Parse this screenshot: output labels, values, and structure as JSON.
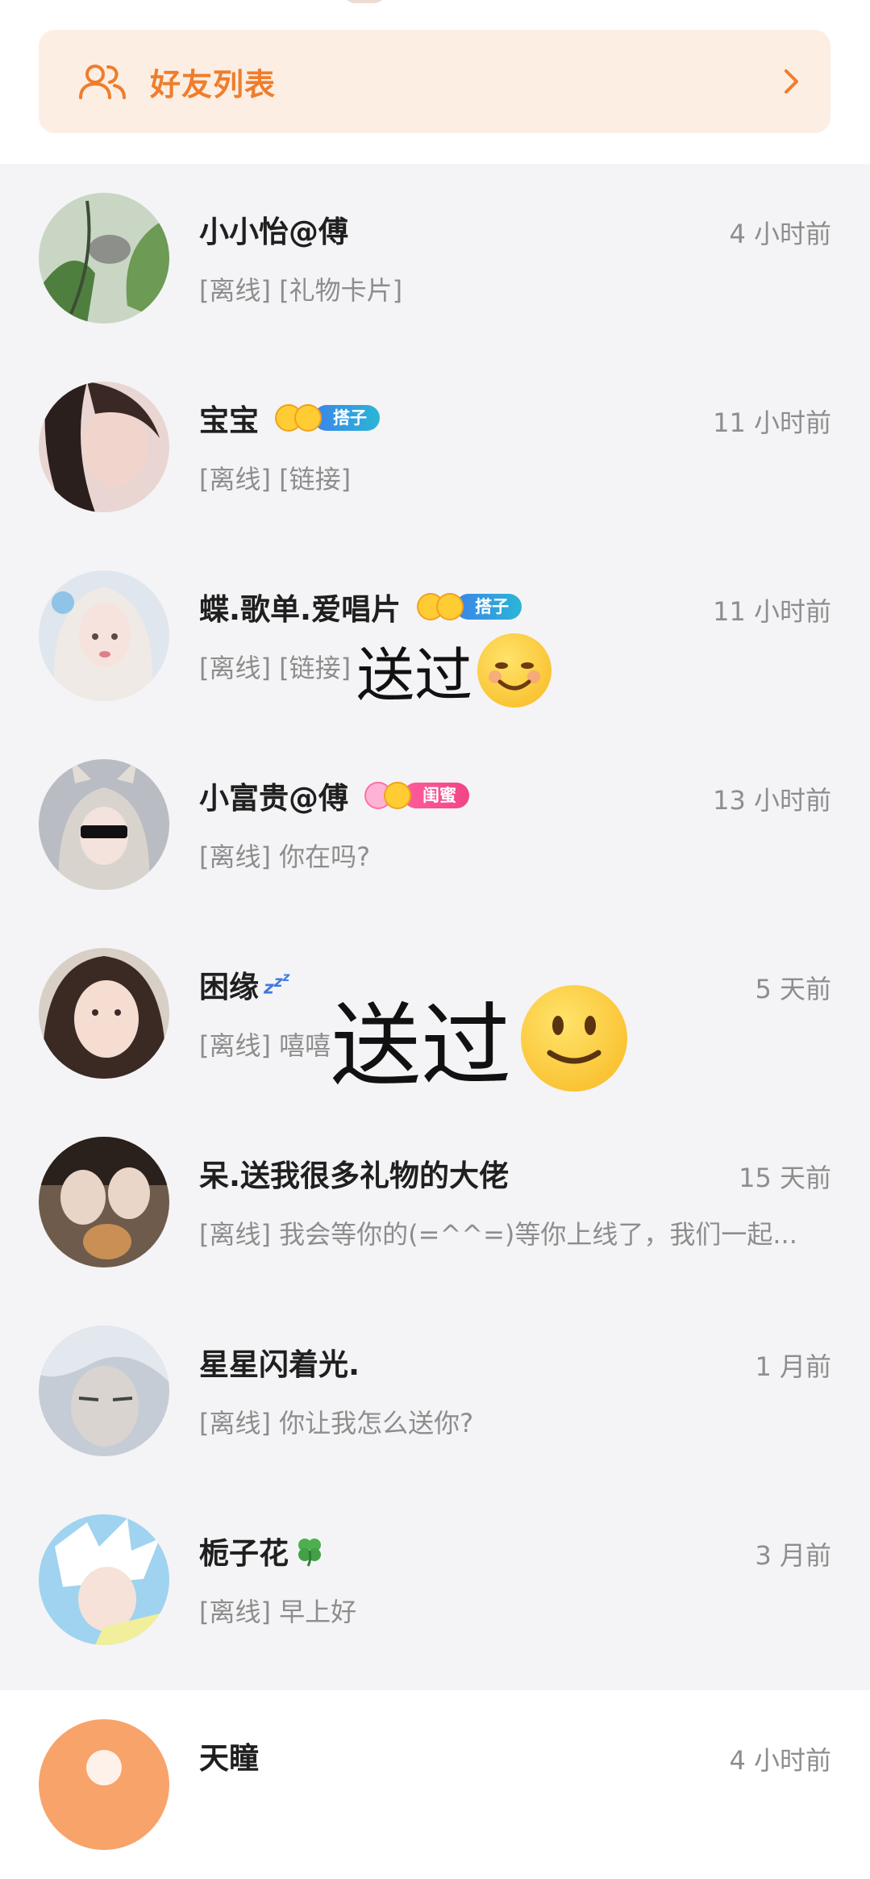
{
  "friend_list": {
    "title": "好友列表"
  },
  "chats": [
    {
      "name": "小小怡@傅",
      "time": "4 小时前",
      "preview": "[离线] [礼物卡片]"
    },
    {
      "name": "宝宝",
      "time": "11 小时前",
      "preview": "[离线] [链接]",
      "badge": "搭子"
    },
    {
      "name": "蝶.歌单.爱唱片",
      "time": "11 小时前",
      "preview": "[离线] [链接]",
      "badge": "搭子"
    },
    {
      "name": "小富贵@傅",
      "time": "13 小时前",
      "preview": "[离线] 你在吗?",
      "badge": "闺蜜"
    },
    {
      "name": "困缘",
      "time": "5 天前",
      "preview": "[离线] 嘻嘻"
    },
    {
      "name": "呆.送我很多礼物的大佬",
      "time": "15 天前",
      "preview": "[离线] 我会等你的(=^^=)等你上线了，我们一起..."
    },
    {
      "name": "星星闪着光.",
      "time": "1 月前",
      "preview": "[离线] 你让我怎么送你?"
    },
    {
      "name": "栀子花",
      "time": "3 月前",
      "preview": "[离线] 早上好"
    },
    {
      "name": "天瞳",
      "time": "4 小时前",
      "preview": ""
    }
  ],
  "overlays": [
    {
      "text": "送过",
      "emoji": "smiling-face-with-smiling-eyes"
    },
    {
      "text": "送过",
      "emoji": "slightly-smiling-face"
    }
  ],
  "colors": {
    "accent": "#ef7d2c",
    "banner_bg": "#fdeee3",
    "list_bg": "#f4f4f6"
  }
}
